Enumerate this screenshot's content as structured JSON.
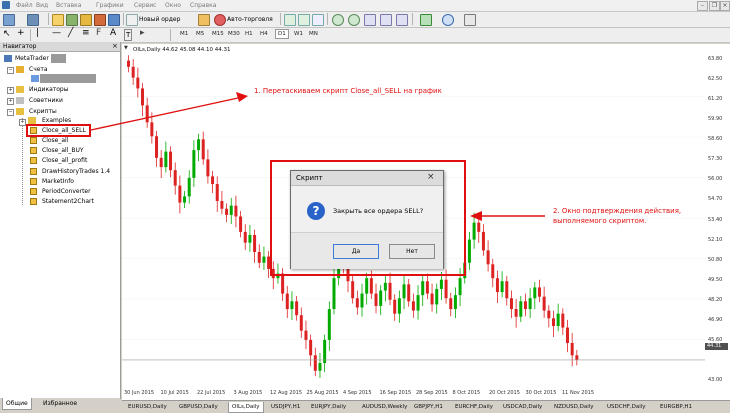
{
  "menu": {
    "items": [
      "Файл",
      "Вид",
      "Вставка",
      "Графики",
      "Сервис",
      "Окно",
      "Справка"
    ]
  },
  "toolbar": {
    "new_order": "Новый ордер",
    "autotrading": "Авто-торговля",
    "timeframes": [
      "M1",
      "M5",
      "M15",
      "M30",
      "H1",
      "H4",
      "D1",
      "W1",
      "MN"
    ]
  },
  "navigator": {
    "title": "Навигатор",
    "root": "MetaTrader",
    "accounts": "Счета",
    "indicators": "Индикаторы",
    "advisors": "Советники",
    "scripts": "Скрипты",
    "script_items": [
      "Examples",
      "Cloce_all_SELL",
      "Close_all",
      "Close_all_BUY",
      "Close_all_profit",
      "DrawHistoryTrades 1.4",
      "MarketInfo",
      "PeriodConverter",
      "Statement2Chart"
    ],
    "tabs": [
      "Общие",
      "Избранное"
    ]
  },
  "chart": {
    "header": "OILs,Daily  44.62 45.08 44.10 44.31",
    "price_label": "44.31",
    "colors": {
      "bull": "#00aa00",
      "bear": "#dd2222",
      "grid": "#c8c8c8",
      "annotation": "#e01010"
    }
  },
  "chart_data": {
    "type": "candlestick",
    "symbol": "OILs",
    "timeframe": "Daily",
    "ylim": [
      43.0,
      64.0
    ],
    "y_ticks": [
      "63.80",
      "62.50",
      "61.20",
      "59.90",
      "58.60",
      "57.30",
      "56.00",
      "54.70",
      "53.40",
      "52.10",
      "50.80",
      "49.50",
      "48.20",
      "46.90",
      "45.60",
      "44.31",
      "43.00"
    ],
    "x_ticks": [
      "30 Jun 2015",
      "10 Jul 2015",
      "22 Jul 2015",
      "3 Aug 2015",
      "12 Aug 2015",
      "25 Aug 2015",
      "4 Sep 2015",
      "16 Sep 2015",
      "28 Sep 2015",
      "8 Oct 2015",
      "20 Oct 2015",
      "30 Oct 2015",
      "11 Nov 2015"
    ],
    "closes": [
      63.3,
      62.6,
      61.9,
      60.8,
      59.7,
      58.8,
      57.4,
      56.8,
      57.8,
      56.6,
      55.6,
      54.5,
      54.9,
      56.1,
      57.9,
      58.6,
      57.3,
      56.2,
      55.7,
      54.6,
      54.1,
      53.7,
      54.3,
      53.6,
      52.6,
      51.9,
      52.4,
      51.3,
      50.6,
      51.0,
      50.2,
      49.6,
      49.9,
      48.6,
      47.6,
      48.1,
      47.2,
      46.2,
      45.6,
      44.6,
      43.6,
      44.1,
      45.6,
      47.6,
      49.6,
      51.1,
      50.5,
      49.4,
      48.3,
      47.7,
      48.6,
      49.6,
      48.6,
      47.8,
      48.8,
      49.3,
      48.2,
      47.3,
      48.3,
      49.2,
      48.1,
      47.5,
      48.5,
      49.4,
      48.6,
      47.9,
      48.9,
      49.5,
      48.3,
      47.6,
      48.5,
      49.6,
      50.6,
      52.1,
      53.2,
      52.6,
      51.4,
      50.5,
      49.6,
      48.7,
      49.4,
      48.3,
      47.6,
      47.1,
      48.1,
      47.6,
      48.3,
      49.0,
      48.4,
      47.5,
      47.0,
      46.5,
      47.3,
      46.4,
      45.4,
      44.6,
      44.3
    ]
  },
  "dialog": {
    "title": "Скрипт",
    "message": "Закрыть все ордера SELL?",
    "yes": "Да",
    "no": "Нет"
  },
  "annotations": {
    "step1": "1. Перетаскиваем скрипт Close_all_SELL на график",
    "step2_line1": "2. Окно подтверждения действия,",
    "step2_line2": "выполняемого скриптом."
  },
  "symbol_tabs": [
    "EURUSD,Daily",
    "GBPUSD,Daily",
    "OILs,Daily",
    "USDJPY,H1",
    "EURJPY,Daily",
    "AUDUSD,Weekly",
    "GBPJPY,H1",
    "EURCHF,Daily",
    "USDCAD,Daily",
    "NZDUSD,Daily",
    "USDCHF,Daily",
    "EURGBP,H1"
  ]
}
